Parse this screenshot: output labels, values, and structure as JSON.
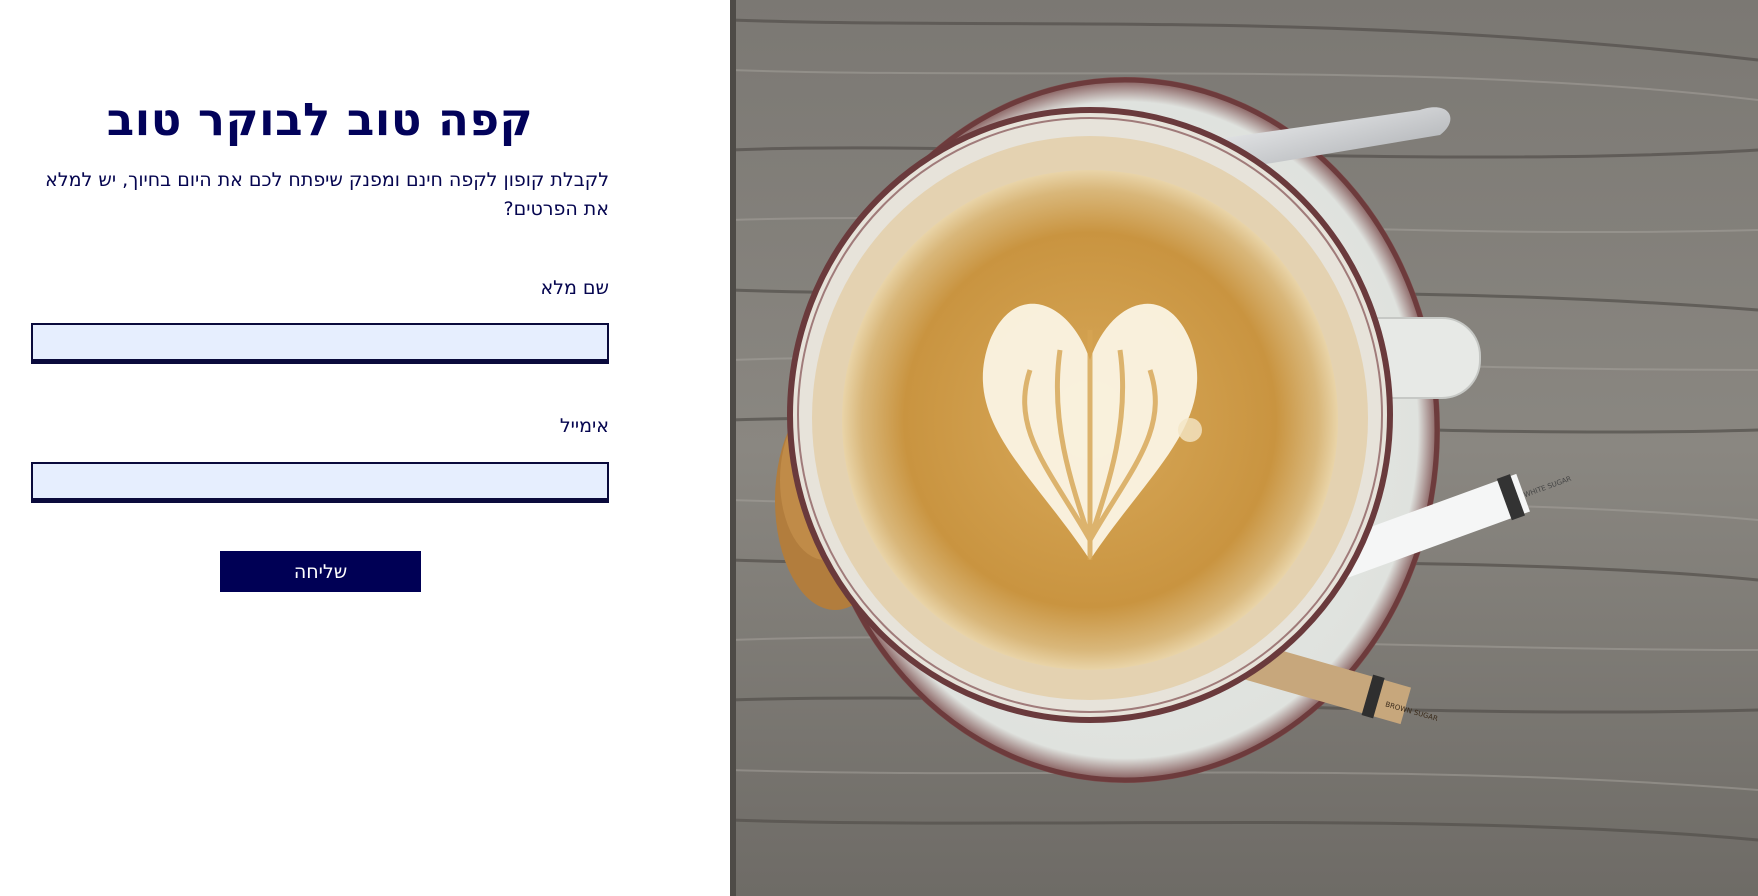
{
  "form": {
    "title": "קפה טוב לבוקר טוב",
    "subtitle": "לקבלת קופון לקפה חינם ומפנק שיפתח לכם את היום בחיוך, יש למלא את הפרטים?",
    "name_label": "שם מלא",
    "name_value": "",
    "email_label": "אימייל",
    "email_value": "",
    "submit_label": "שליחה"
  },
  "photo": {
    "sugar_white_text": "WHITE SUGAR",
    "sugar_brown_text": "BROWN SUGAR"
  },
  "colors": {
    "brand": "#000055",
    "text": "#05054f",
    "input_bg": "#e6eefe"
  }
}
